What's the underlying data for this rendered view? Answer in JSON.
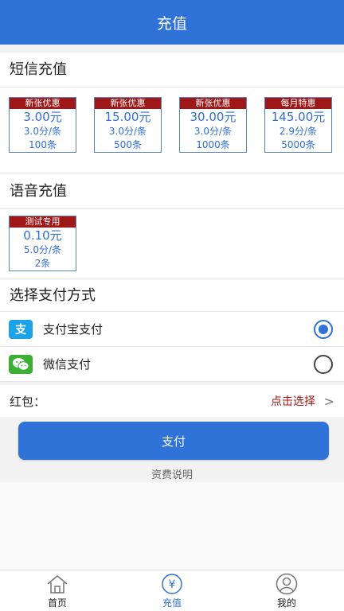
{
  "header": {
    "title": "充值"
  },
  "sms": {
    "title": "短信充值",
    "packages": [
      {
        "tag": "新张优惠",
        "price": "3.00元",
        "rate": "3.0分/条",
        "count": "100条"
      },
      {
        "tag": "新张优惠",
        "price": "15.00元",
        "rate": "3.0分/条",
        "count": "500条"
      },
      {
        "tag": "新张优惠",
        "price": "30.00元",
        "rate": "3.0分/条",
        "count": "1000条"
      },
      {
        "tag": "每月特惠",
        "price": "145.00元",
        "rate": "2.9分/条",
        "count": "5000条"
      }
    ]
  },
  "voice": {
    "title": "语音充值",
    "packages": [
      {
        "tag": "测试专用",
        "price": "0.10元",
        "rate": "5.0分/条",
        "count": "2条"
      }
    ]
  },
  "payment": {
    "title": "选择支付方式",
    "methods": [
      {
        "label": "支付宝支付",
        "icon": "alipay-icon",
        "icon_char": "支",
        "color": "#1aa3e8",
        "selected": true
      },
      {
        "label": "微信支付",
        "icon": "wechat-icon",
        "color": "#3cb034",
        "selected": false
      }
    ]
  },
  "hongbao": {
    "label": "红包：",
    "select_text": "点击选择",
    "chevron": ">"
  },
  "pay_button": "支付",
  "fee_link": "资费说明",
  "tabs": [
    {
      "label": "首页",
      "icon": "home-icon"
    },
    {
      "label": "充值",
      "icon": "yuan-icon",
      "icon_char": "¥",
      "active": true
    },
    {
      "label": "我的",
      "icon": "user-icon"
    }
  ],
  "colors": {
    "primary": "#2f72d8",
    "tag_red": "#a01717",
    "price_blue": "#2f6fd6"
  }
}
